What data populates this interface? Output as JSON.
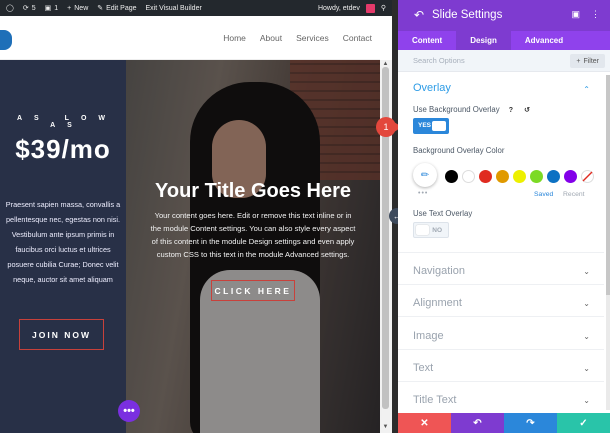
{
  "adminbar": {
    "count": "5",
    "comments": "1",
    "new": "New",
    "edit_page": "Edit Page",
    "exit_builder": "Exit Visual Builder",
    "howdy": "Howdy, etdev"
  },
  "nav": [
    "Home",
    "About",
    "Services",
    "Contact"
  ],
  "left": {
    "as_low_as": "AS LOW AS",
    "price": "$39/mo",
    "text": "Praesent sapien massa, convallis a pellentesque nec, egestas non nisi. Vestibulum ante ipsum primis in faucibus orci luctus et ultrices posuere cubilia Curae; Donec velit neque, auctor sit amet aliquam",
    "button": "JOIN NOW"
  },
  "slide": {
    "title": "Your Title Goes Here",
    "text": "Your content goes here. Edit or remove this text inline or in the module Content settings. You can also style every aspect of this content in the module Design settings and even apply custom CSS to this text in the module Advanced settings.",
    "button": "CLICK HERE"
  },
  "panel": {
    "title": "Slide Settings",
    "tabs": [
      "Content",
      "Design",
      "Advanced"
    ],
    "active_tab": "Design",
    "search_placeholder": "Search Options",
    "filter": "Filter",
    "overlay_heading": "Overlay",
    "use_bg_overlay_label": "Use Background Overlay",
    "use_bg_overlay_value": "YES",
    "bg_overlay_color_label": "Background Overlay Color",
    "swatches": [
      "#000000",
      "#ffffff",
      "#e02b20",
      "#e09900",
      "#edf000",
      "#7cda24",
      "#0c71c3",
      "#8300e9"
    ],
    "saved": "Saved",
    "recent": "Recent",
    "use_text_overlay_label": "Use Text Overlay",
    "use_text_overlay_value": "NO",
    "sections": [
      "Navigation",
      "Alignment",
      "Image",
      "Text",
      "Title Text"
    ],
    "callout_number": "1"
  },
  "colors": {
    "accent_purple": "#7e3bd0",
    "blue": "#2b87da",
    "red": "#e3473c"
  }
}
